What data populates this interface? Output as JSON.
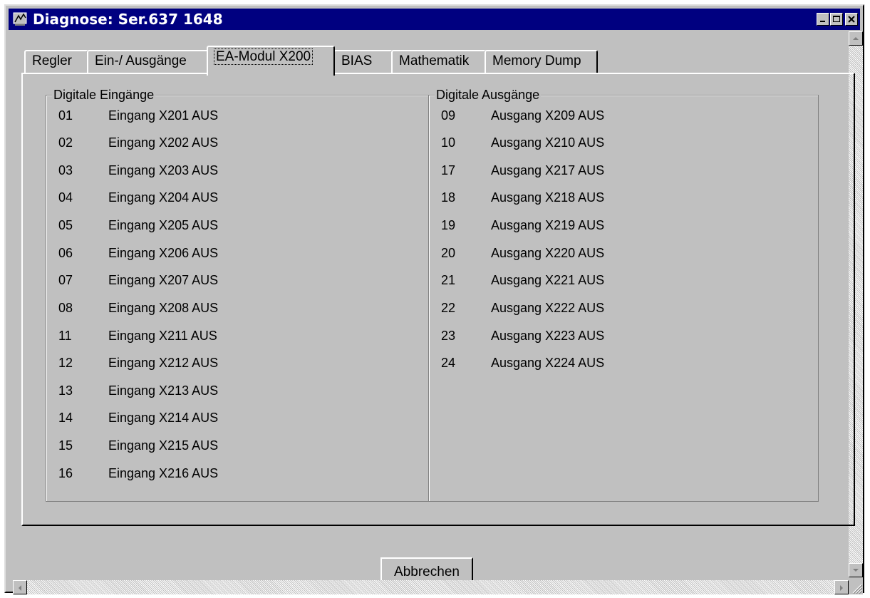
{
  "window": {
    "title": "Diagnose: Ser.637 1648"
  },
  "tabs": [
    {
      "label": "Regler"
    },
    {
      "label": "Ein-/ Ausgänge"
    },
    {
      "label": "EA-Modul X200",
      "active": true
    },
    {
      "label": "BIAS"
    },
    {
      "label": "Mathematik"
    },
    {
      "label": "Memory Dump"
    }
  ],
  "inputs": {
    "title": "Digitale Eingänge",
    "rows": [
      {
        "num": "01",
        "label": "Eingang X201 AUS"
      },
      {
        "num": "02",
        "label": "Eingang X202 AUS"
      },
      {
        "num": "03",
        "label": "Eingang X203 AUS"
      },
      {
        "num": "04",
        "label": "Eingang X204 AUS"
      },
      {
        "num": "05",
        "label": "Eingang X205 AUS"
      },
      {
        "num": "06",
        "label": "Eingang X206 AUS"
      },
      {
        "num": "07",
        "label": "Eingang X207 AUS"
      },
      {
        "num": "08",
        "label": "Eingang X208 AUS"
      },
      {
        "num": "11",
        "label": "Eingang X211 AUS"
      },
      {
        "num": "12",
        "label": "Eingang X212 AUS"
      },
      {
        "num": "13",
        "label": "Eingang X213 AUS"
      },
      {
        "num": "14",
        "label": "Eingang X214 AUS"
      },
      {
        "num": "15",
        "label": "Eingang X215 AUS"
      },
      {
        "num": "16",
        "label": "Eingang X216 AUS"
      }
    ]
  },
  "outputs": {
    "title": "Digitale Ausgänge",
    "rows": [
      {
        "num": "09",
        "label": "Ausgang X209 AUS"
      },
      {
        "num": "10",
        "label": "Ausgang X210 AUS"
      },
      {
        "num": "17",
        "label": "Ausgang X217 AUS"
      },
      {
        "num": "18",
        "label": "Ausgang X218 AUS"
      },
      {
        "num": "19",
        "label": "Ausgang X219 AUS"
      },
      {
        "num": "20",
        "label": "Ausgang X220 AUS"
      },
      {
        "num": "21",
        "label": "Ausgang X221 AUS"
      },
      {
        "num": "22",
        "label": "Ausgang X222 AUS"
      },
      {
        "num": "23",
        "label": "Ausgang X223 AUS"
      },
      {
        "num": "24",
        "label": "Ausgang X224 AUS"
      }
    ]
  },
  "buttons": {
    "cancel": "Abbrechen"
  },
  "colors": {
    "titlebar": "#000080",
    "face": "#c0c0c0",
    "text": "#000000"
  },
  "icons": {
    "app": "diagnose-app-icon",
    "minimize": "minimize-icon",
    "maximize": "maximize-icon",
    "close": "close-icon"
  }
}
